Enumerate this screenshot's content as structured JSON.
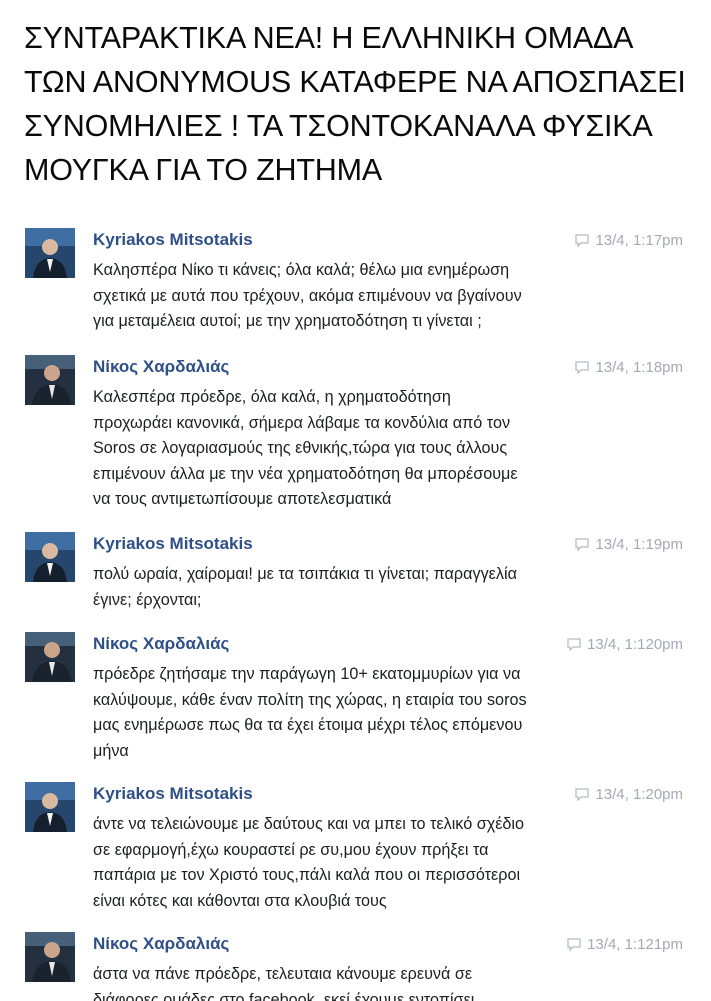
{
  "headline": {
    "lines": [
      "ΣΥΝΤΑΡΑΚΤΙΚΑ ΝΕΑ! Η ΕΛΛΗΝΙΚΗ ΟΜΑΔΑ",
      "ΤΩΝ ΑΝΟΝΥΜΟUS ΚΑΤΑΦΕΡΕ ΝΑ ΑΠΟΣΠΑΣΕΙ",
      "ΣΥΝΟΜΗΛΙΕΣ ! ΤΑ ΤΣΟΝΤΟΚΑΝΑΛΑ ΦΥΣΙΚΑ",
      "ΜΟΥΓΚΑ ΓΙΑ ΤΟ ΖΗΤΗΜΑ"
    ]
  },
  "messages": [
    {
      "sender": "Kyriakos Mitsotakis",
      "time": "13/4, 1:17pm",
      "avatar_icon": "profile-photo-icon",
      "lines": [
        "Καλησπέρα Νίκο τι κάνεις; όλα καλά; θέλω μια ενημέρωση",
        "σχετικά με αυτά που τρέχουν, ακόμα επιμένουν να βγαίνουν",
        "για μεταμέλεια αυτοί; με την χρηματοδότηση τι γίνεται ;"
      ]
    },
    {
      "sender": "Νίκος Χαρδαλιάς",
      "time": "13/4, 1:18pm",
      "avatar_icon": "profile-photo-icon",
      "lines": [
        "Καλεσπέρα πρόεδρε, όλα καλά, η χρηματοδότηση",
        "προχωράει κανονικά, σήμερα λάβαμε τα κονδύλια από τον",
        "Soros σε λογαριασμούς της εθνικής,τώρα για τους άλλους",
        "επιμένουν άλλα με την νέα χρηματοδότηση θα μπορέσουμε",
        "να τους αντιμετωπίσουμε αποτελεσματικά"
      ]
    },
    {
      "sender": "Kyriakos Mitsotakis",
      "time": "13/4, 1:19pm",
      "avatar_icon": "profile-photo-icon",
      "lines": [
        "πολύ ωραία, χαίρομαι! με τα τσιπάκια τι γίνεται; παραγγελία",
        "έγινε; έρχονται;"
      ]
    },
    {
      "sender": "Νίκος Χαρδαλιάς",
      "time": "13/4, 1:120pm",
      "avatar_icon": "profile-photo-icon",
      "lines": [
        "πρόεδρε ζητήσαμε την παράγωγη 10+ εκατομμυρίων για να",
        "καλύψουμε, κάθε έναν πολίτη της χώρας, η εταιρία του soros",
        "μας ενημέρωσε πως θα τα έχει έτοιμα μέχρι τέλος επόμενου",
        "μήνα"
      ]
    },
    {
      "sender": "Kyriakos Mitsotakis",
      "time": "13/4, 1:20pm",
      "avatar_icon": "profile-photo-icon",
      "lines": [
        "άντε να τελειώνουμε με δαύτους και να μπει το τελικό σχέδιο",
        "σε εφαρμογή,έχω κουραστεί ρε συ,μου έχουν πρήξει τα",
        "παπάρια με τον Χριστό τους,πάλι καλά που οι περισσότεροι",
        "είναι κότες και κάθονται στα κλουβιά τους"
      ]
    },
    {
      "sender": "Νίκος Χαρδαλιάς",
      "time": "13/4, 1:121pm",
      "avatar_icon": "profile-photo-icon",
      "lines": [
        "άστα να πάνε πρόεδρε, τελευταια κάνουμε ερευνά σε",
        "διάφορες ομάδες στο facebook, εκεί έχουμε εντοπίσει"
      ]
    }
  ],
  "colors": {
    "sender_link": "#2e4f87",
    "timestamp": "#a4a9b3",
    "body_text": "#1c1e21"
  }
}
